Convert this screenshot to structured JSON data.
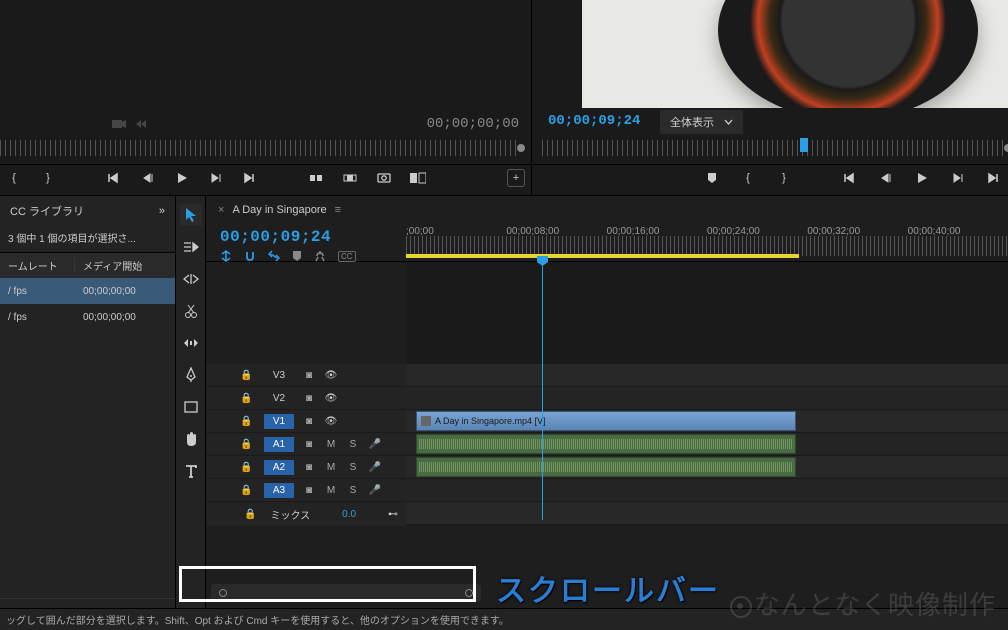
{
  "source": {
    "timecode": "00;00;00;00"
  },
  "program": {
    "timecode": "00;00;09;24",
    "zoom_label": "全体表示"
  },
  "project": {
    "tab_label": "CC ライブラリ",
    "selection_text": "3 個中 1 個の項目が選択さ...",
    "col_a": "ームレート",
    "col_b": "メディア開始",
    "rows": [
      {
        "fps": "/ fps",
        "tc": "00;00;00;00"
      },
      {
        "fps": "/ fps",
        "tc": "00;00;00;00"
      }
    ]
  },
  "timeline": {
    "sequence_name": "A Day in Singapore",
    "timecode": "00;00;09;24",
    "time_labels": [
      ";00;00",
      "00;00;08;00",
      "00;00;16;00",
      "00;00;24;00",
      "00;00;32;00",
      "00;00;40;00"
    ],
    "tracks": {
      "video": [
        {
          "name": "V3"
        },
        {
          "name": "V2"
        },
        {
          "name": "V1",
          "highlight": true
        }
      ],
      "audio": [
        {
          "name": "A1",
          "highlight": true
        },
        {
          "name": "A2",
          "highlight": true
        },
        {
          "name": "A3",
          "highlight": true
        }
      ]
    },
    "video_clip_label": "A Day in Singapore.mp4 [V]",
    "mix_label": "ミックス",
    "mix_value": "0.0",
    "mute": "M",
    "solo": "S"
  },
  "annotation_label": "スクロールバー",
  "status_text": "ッグして囲んだ部分を選択します。Shift、Opt および Cmd キーを使用すると、他のオプションを使用できます。",
  "watermark_text": "なんとなく映像制作"
}
